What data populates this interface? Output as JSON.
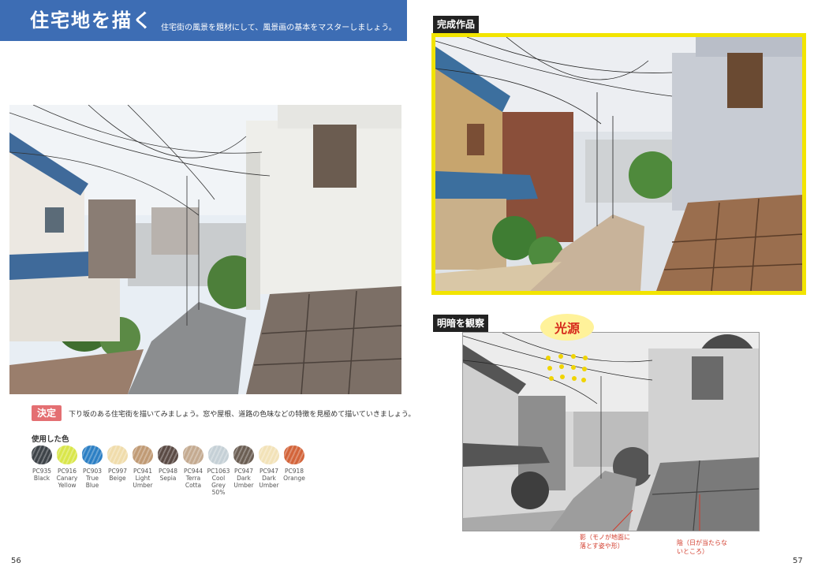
{
  "header": {
    "title": "住宅地を描く",
    "subtitle": "住宅街の風景を題材にして、風景画の基本をマスターしましょう。"
  },
  "sections": {
    "final_label": "完成作品",
    "light_label": "明暗を観察"
  },
  "decision": {
    "badge": "決定",
    "text": "下り坂のある住宅街を描いてみましょう。窓や屋根、道路の色味などの特徴を見極めて描いていきましょう。"
  },
  "colors": {
    "heading": "使用した色",
    "swatches": [
      {
        "code": "PC935",
        "name": "Black",
        "hex": "#3d4348"
      },
      {
        "code": "PC916",
        "name": "Canary\nYellow",
        "hex": "#d9e64a"
      },
      {
        "code": "PC903",
        "name": "True\nBlue",
        "hex": "#2c7fc4"
      },
      {
        "code": "PC997",
        "name": "Beige",
        "hex": "#f0dcab"
      },
      {
        "code": "PC941",
        "name": "Light\nUmber",
        "hex": "#c09a74"
      },
      {
        "code": "PC948",
        "name": "Sepia",
        "hex": "#5a4a44"
      },
      {
        "code": "PC944",
        "name": "Terra\nCotta",
        "hex": "#c4aa90"
      },
      {
        "code": "PC1063",
        "name": "Cool\nGrey\n50%",
        "hex": "#c5d0d6"
      },
      {
        "code": "PC947",
        "name": "Dark\nUmber",
        "hex": "#6b5e53"
      },
      {
        "code": "PC947",
        "name": "Dark\nUmber",
        "hex": "#f2e2b8"
      },
      {
        "code": "PC918",
        "name": "Orange",
        "hex": "#d3643a"
      }
    ]
  },
  "light_source": "光源",
  "annotations": {
    "shadow": "影（モノが地面に\n落とす姿や形）",
    "shade": "陰（日が当たらな\nいところ）"
  },
  "pages": {
    "left": "56",
    "right": "57"
  }
}
